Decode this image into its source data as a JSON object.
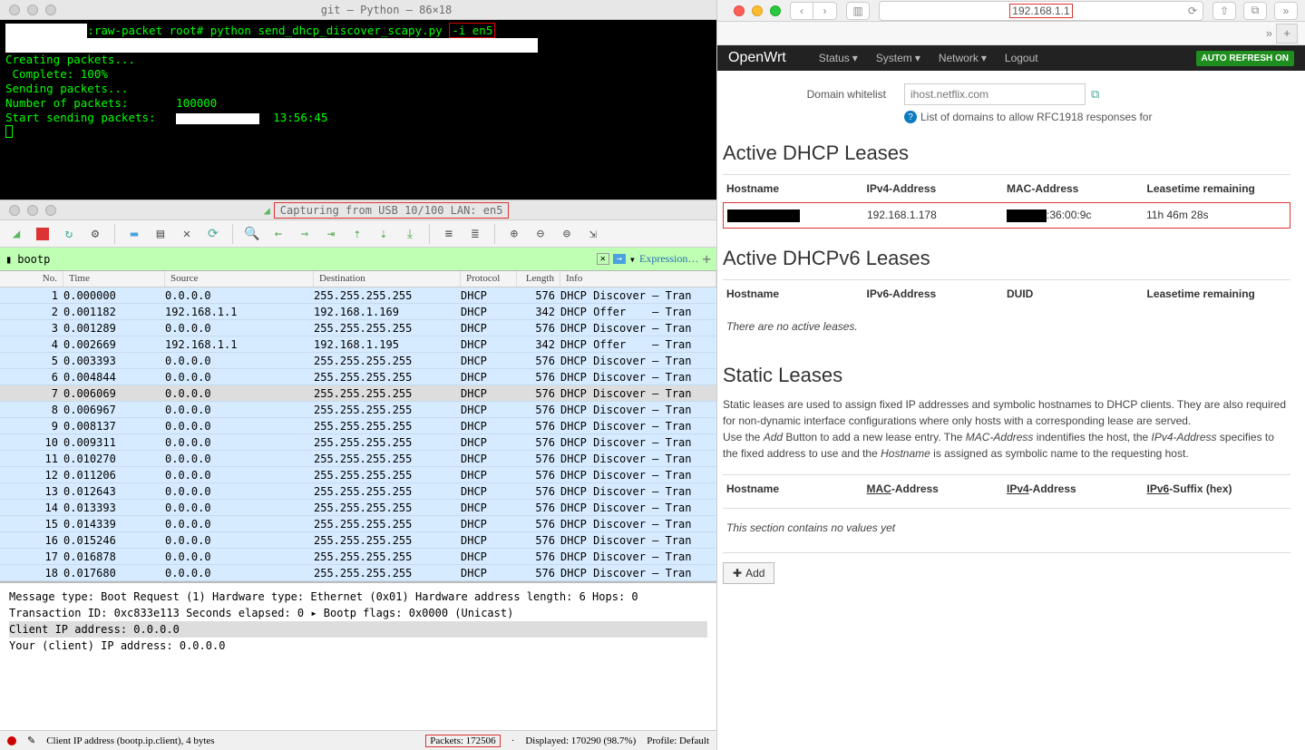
{
  "terminal": {
    "title": "git — Python — 86×18",
    "prompt": ":raw-packet root# python send_dhcp_discover_scapy.py",
    "prompt_args": "-i en5",
    "lines": {
      "l1": "Creating packets...",
      "l2": " Complete: 100%",
      "l3": "Sending packets...",
      "l4a": "Number of packets:",
      "l4b": "100000",
      "l5a": "Start sending packets:",
      "l5b": "13:56:45"
    }
  },
  "wireshark": {
    "title": "Capturing from USB 10/100 LAN: en5",
    "filter": "bootp",
    "expr_label": "Expression…",
    "cols": {
      "no": "No.",
      "time": "Time",
      "src": "Source",
      "dst": "Destination",
      "proto": "Protocol",
      "len": "Length",
      "info": "Info"
    },
    "rows": [
      {
        "n": "1",
        "t": "0.000000",
        "s": "0.0.0.0",
        "d": "255.255.255.255",
        "p": "DHCP",
        "l": "576",
        "i": "DHCP Discover – Tran"
      },
      {
        "n": "2",
        "t": "0.001182",
        "s": "192.168.1.1",
        "d": "192.168.1.169",
        "p": "DHCP",
        "l": "342",
        "i": "DHCP Offer    – Tran"
      },
      {
        "n": "3",
        "t": "0.001289",
        "s": "0.0.0.0",
        "d": "255.255.255.255",
        "p": "DHCP",
        "l": "576",
        "i": "DHCP Discover – Tran"
      },
      {
        "n": "4",
        "t": "0.002669",
        "s": "192.168.1.1",
        "d": "192.168.1.195",
        "p": "DHCP",
        "l": "342",
        "i": "DHCP Offer    – Tran"
      },
      {
        "n": "5",
        "t": "0.003393",
        "s": "0.0.0.0",
        "d": "255.255.255.255",
        "p": "DHCP",
        "l": "576",
        "i": "DHCP Discover – Tran"
      },
      {
        "n": "6",
        "t": "0.004844",
        "s": "0.0.0.0",
        "d": "255.255.255.255",
        "p": "DHCP",
        "l": "576",
        "i": "DHCP Discover – Tran"
      },
      {
        "n": "7",
        "t": "0.006069",
        "s": "0.0.0.0",
        "d": "255.255.255.255",
        "p": "DHCP",
        "l": "576",
        "i": "DHCP Discover – Tran",
        "sel": true
      },
      {
        "n": "8",
        "t": "0.006967",
        "s": "0.0.0.0",
        "d": "255.255.255.255",
        "p": "DHCP",
        "l": "576",
        "i": "DHCP Discover – Tran"
      },
      {
        "n": "9",
        "t": "0.008137",
        "s": "0.0.0.0",
        "d": "255.255.255.255",
        "p": "DHCP",
        "l": "576",
        "i": "DHCP Discover – Tran"
      },
      {
        "n": "10",
        "t": "0.009311",
        "s": "0.0.0.0",
        "d": "255.255.255.255",
        "p": "DHCP",
        "l": "576",
        "i": "DHCP Discover – Tran"
      },
      {
        "n": "11",
        "t": "0.010270",
        "s": "0.0.0.0",
        "d": "255.255.255.255",
        "p": "DHCP",
        "l": "576",
        "i": "DHCP Discover – Tran"
      },
      {
        "n": "12",
        "t": "0.011206",
        "s": "0.0.0.0",
        "d": "255.255.255.255",
        "p": "DHCP",
        "l": "576",
        "i": "DHCP Discover – Tran"
      },
      {
        "n": "13",
        "t": "0.012643",
        "s": "0.0.0.0",
        "d": "255.255.255.255",
        "p": "DHCP",
        "l": "576",
        "i": "DHCP Discover – Tran"
      },
      {
        "n": "14",
        "t": "0.013393",
        "s": "0.0.0.0",
        "d": "255.255.255.255",
        "p": "DHCP",
        "l": "576",
        "i": "DHCP Discover – Tran"
      },
      {
        "n": "15",
        "t": "0.014339",
        "s": "0.0.0.0",
        "d": "255.255.255.255",
        "p": "DHCP",
        "l": "576",
        "i": "DHCP Discover – Tran"
      },
      {
        "n": "16",
        "t": "0.015246",
        "s": "0.0.0.0",
        "d": "255.255.255.255",
        "p": "DHCP",
        "l": "576",
        "i": "DHCP Discover – Tran"
      },
      {
        "n": "17",
        "t": "0.016878",
        "s": "0.0.0.0",
        "d": "255.255.255.255",
        "p": "DHCP",
        "l": "576",
        "i": "DHCP Discover – Tran"
      },
      {
        "n": "18",
        "t": "0.017680",
        "s": "0.0.0.0",
        "d": "255.255.255.255",
        "p": "DHCP",
        "l": "576",
        "i": "DHCP Discover – Tran"
      }
    ],
    "detail": {
      "d1": "  Message type: Boot Request (1)",
      "d2": "  Hardware type: Ethernet (0x01)",
      "d3": "  Hardware address length: 6",
      "d4": "  Hops: 0",
      "d5": "  Transaction ID: 0xc833e113",
      "d6": "  Seconds elapsed: 0",
      "d7": "▸ Bootp flags: 0x0000 (Unicast)",
      "d8": "  Client IP address: 0.0.0.0",
      "d9": "  Your (client) IP address: 0.0.0.0"
    },
    "status": {
      "field": "Client IP address (bootp.ip.client), 4 bytes",
      "packets": "Packets: 172506",
      "displayed": "Displayed: 170290 (98.7%)",
      "profile": "Profile: Default"
    }
  },
  "browser": {
    "url": "192.168.1.1"
  },
  "openwrt": {
    "brand": "OpenWrt",
    "menu": {
      "status": "Status",
      "system": "System",
      "network": "Network",
      "logout": "Logout"
    },
    "refresh": "AUTO REFRESH ON",
    "whitelist_label": "Domain whitelist",
    "whitelist_ph": "ihost.netflix.com",
    "help": "List of domains to allow RFC1918 responses for",
    "sections": {
      "dhcp4": {
        "title": "Active DHCP Leases",
        "cols": {
          "host": "Hostname",
          "ipv4": "IPv4-Address",
          "mac": "MAC-Address",
          "lease": "Leasetime remaining"
        },
        "row": {
          "ip": "192.168.1.178",
          "mac": ":36:00:9c",
          "lease": "11h 46m 28s"
        }
      },
      "dhcp6": {
        "title": "Active DHCPv6 Leases",
        "cols": {
          "host": "Hostname",
          "ipv6": "IPv6-Address",
          "duid": "DUID",
          "lease": "Leasetime remaining"
        },
        "empty": "There are no active leases."
      },
      "static": {
        "title": "Static Leases",
        "desc1": "Static leases are used to assign fixed IP addresses and symbolic hostnames to DHCP clients. They are also required for non-dynamic interface configurations where only hosts with a corresponding lease are served.",
        "desc2a": "Use the ",
        "add": "Add",
        "desc2b": " Button to add a new lease entry. The ",
        "mac": "MAC-Address",
        "desc2c": " indentifies the host, the ",
        "ipv4": "IPv4-Address",
        "desc2d": " specifies to the fixed address to use and the ",
        "host": "Hostname",
        "desc2e": " is assigned as symbolic name to the requesting host.",
        "cols": {
          "host": "Hostname",
          "mac": "MAC",
          "macb": "-Address",
          "ipv4": "IPv4",
          "ipv4b": "-Address",
          "ipv6": "IPv6",
          "ipv6b": "-Suffix (hex)"
        },
        "empty": "This section contains no values yet",
        "add_btn": "Add"
      }
    }
  }
}
